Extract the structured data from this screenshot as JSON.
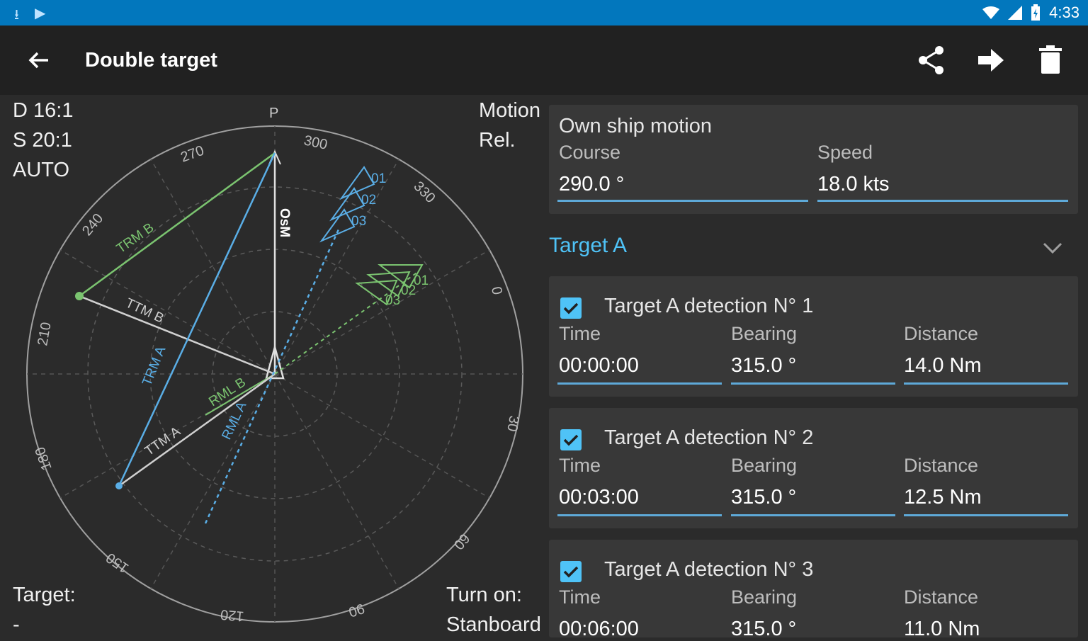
{
  "status_bar": {
    "time": "4:33",
    "icons": [
      "download-icon",
      "play-store-icon",
      "wifi-icon",
      "signal-icon",
      "battery-icon"
    ]
  },
  "app_bar": {
    "title": "Double target",
    "actions": [
      "share-icon",
      "forward-icon",
      "delete-icon"
    ]
  },
  "plot": {
    "d_ratio": "D 16:1",
    "s_ratio": "S 20:1",
    "mode": "AUTO",
    "motion_label": "Motion",
    "motion_value": "Rel.",
    "target_label": "Target:",
    "target_value": "-",
    "turn_label": "Turn on:",
    "turn_value": "Stanboard",
    "north_marker": "P",
    "bearing_labels": [
      "300",
      "330",
      "0",
      "30",
      "60",
      "90",
      "120",
      "150",
      "180",
      "210",
      "240",
      "270"
    ],
    "vector_labels": {
      "osm": "OsM",
      "trm_b": "TRM B",
      "ttm_b": "TTM B",
      "trm_a": "TRM A",
      "ttm_a": "TTM A",
      "rml_b": "RML B",
      "rml_a": "RML A",
      "det_a": [
        "01",
        "02",
        "03"
      ],
      "det_b": [
        "01",
        "02",
        "03"
      ]
    },
    "colors": {
      "green": "#7bc470",
      "blue": "#5aaee6",
      "white": "#e0e0e0",
      "ring": "#9e9e9e"
    }
  },
  "own_ship": {
    "title": "Own ship motion",
    "course_label": "Course",
    "course_value": "290.0 °",
    "speed_label": "Speed",
    "speed_value": "18.0 kts"
  },
  "target_a": {
    "title": "Target A",
    "detections": [
      {
        "title": "Target A detection N° 1",
        "time_label": "Time",
        "time": "00:00:00",
        "bearing_label": "Bearing",
        "bearing": "315.0 °",
        "distance_label": "Distance",
        "distance": "14.0 Nm",
        "checked": true
      },
      {
        "title": "Target A detection N° 2",
        "time_label": "Time",
        "time": "00:03:00",
        "bearing_label": "Bearing",
        "bearing": "315.0 °",
        "distance_label": "Distance",
        "distance": "12.5 Nm",
        "checked": true
      },
      {
        "title": "Target A detection N° 3",
        "time_label": "Time",
        "time": "00:06:00",
        "bearing_label": "Bearing",
        "bearing": "315.0 °",
        "distance_label": "Distance",
        "distance": "11.0 Nm",
        "checked": true
      }
    ]
  }
}
